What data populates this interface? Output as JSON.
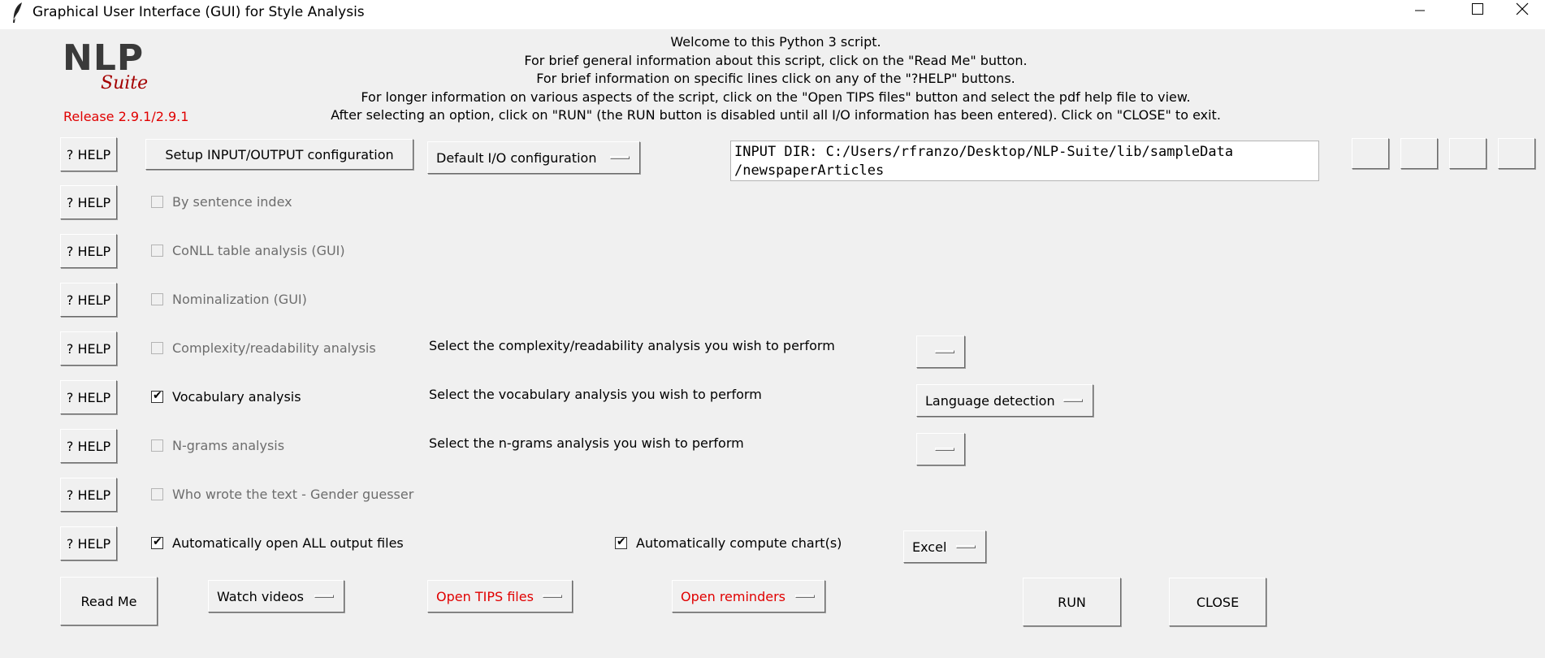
{
  "window": {
    "title": "Graphical User Interface (GUI) for Style Analysis"
  },
  "logo": {
    "nlp": "NLP",
    "suite": "Suite",
    "release": "Release 2.9.1/2.9.1"
  },
  "welcome": [
    "Welcome to this Python 3 script.",
    "For brief general information about this script, click on the \"Read Me\" button.",
    "For brief information on specific lines click on any of the \"?HELP\" buttons.",
    "For longer information on various aspects of the script, click on the \"Open TIPS files\" button and select the pdf help file to view.",
    "After selecting an option, click on \"RUN\" (the RUN button is disabled until all I/O information has been entered).   Click on \"CLOSE\" to exit."
  ],
  "help_label": "? HELP",
  "io": {
    "setup_label": "Setup INPUT/OUTPUT configuration",
    "config_value": "Default I/O configuration",
    "input_dir": "INPUT DIR: C:/Users/rfranzo/Desktop/NLP-Suite/lib/sampleData\n/newspaperArticles"
  },
  "options": {
    "by_sentence_index": "By sentence index",
    "conll": "CoNLL table analysis (GUI)",
    "nominalization": "Nominalization (GUI)",
    "complexity": "Complexity/readability analysis",
    "vocabulary": "Vocabulary analysis",
    "ngrams": "N-grams analysis",
    "gender": "Who wrote the text - Gender guesser",
    "open_output": "Automatically open ALL output files",
    "compute_charts": "Automatically compute chart(s)"
  },
  "prompts": {
    "complexity": "Select the complexity/readability analysis you wish to perform",
    "vocabulary": "Select the vocabulary analysis you wish to perform",
    "ngrams": "Select the n-grams analysis you wish to perform"
  },
  "selects": {
    "complexity_value": "",
    "vocabulary_value": "Language detection",
    "ngrams_value": "",
    "chart_package": "Excel"
  },
  "bottom": {
    "read_me": "Read Me",
    "watch_videos": "Watch videos",
    "open_tips": "Open TIPS files",
    "open_reminders": "Open reminders",
    "run": "RUN",
    "close": "CLOSE"
  },
  "colors": {
    "accent_red": "#e00000",
    "logo_red": "#a40000",
    "window_bg": "#f0f0f0"
  }
}
